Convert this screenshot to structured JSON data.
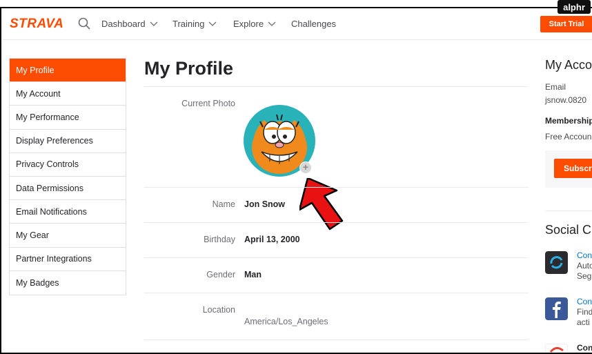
{
  "watermark": "alphr",
  "brand": {
    "logo": "STRAVA",
    "accent": "#fc4c02"
  },
  "nav": {
    "items": [
      {
        "label": "Dashboard",
        "has_dropdown": true
      },
      {
        "label": "Training",
        "has_dropdown": true
      },
      {
        "label": "Explore",
        "has_dropdown": true
      },
      {
        "label": "Challenges",
        "has_dropdown": false
      }
    ],
    "trial_button": "Start Trial"
  },
  "sidebar": {
    "items": [
      {
        "label": "My Profile",
        "active": true
      },
      {
        "label": "My Account"
      },
      {
        "label": "My Performance"
      },
      {
        "label": "Display Preferences"
      },
      {
        "label": "Privacy Controls"
      },
      {
        "label": "Data Permissions"
      },
      {
        "label": "Email Notifications"
      },
      {
        "label": "My Gear"
      },
      {
        "label": "Partner Integrations"
      },
      {
        "label": "My Badges"
      }
    ]
  },
  "profile": {
    "title": "My Profile",
    "photo_label": "Current Photo",
    "name_label": "Name",
    "name": "Jon Snow",
    "birthday_label": "Birthday",
    "birthday": "April 13, 2000",
    "gender_label": "Gender",
    "gender": "Man",
    "location_label": "Location",
    "location": "America/Los_Angeles"
  },
  "account": {
    "title": "My Acco",
    "email_label": "Email",
    "email": "jsnow.0820",
    "membership_label": "Membership",
    "membership": "Free Accoun",
    "subscribe": "Subscri"
  },
  "social": {
    "title": "Social C",
    "apps": [
      {
        "line1": "Con",
        "line2": "Auto",
        "line3": "Seg",
        "icon": "sync-icon"
      },
      {
        "line1": "Con",
        "line2": "Find",
        "line3": "acti",
        "icon": "facebook-icon"
      },
      {
        "line1": "Con",
        "icon": "google-icon"
      }
    ]
  }
}
